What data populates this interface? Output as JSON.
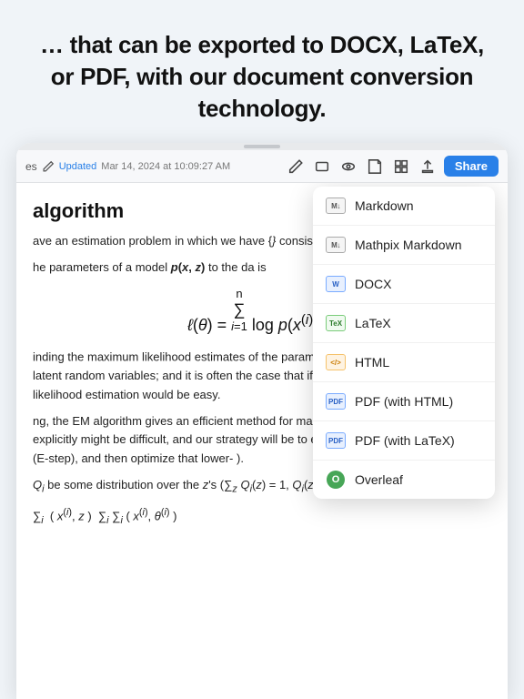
{
  "headline": {
    "text": "… that can be exported to DOCX, LaTeX, or PDF, with our document conversion technology."
  },
  "toolbar": {
    "filename": "es",
    "edit_icon": "pencil",
    "updated_label": "Updated",
    "date": "Mar 14, 2024 at 10:09:27 AM",
    "icons": [
      "pencil-icon",
      "rectangle-icon",
      "eye-icon",
      "document-icon",
      "grid-icon",
      "upload-icon"
    ],
    "share_label": "Share"
  },
  "document": {
    "title": "algorithm",
    "paragraphs": [
      "ave an estimation problem in which we have {} consisting of m independent examples.",
      "he parameters of a model p(x, z) to the da is",
      "",
      "inding the maximum likelihood estimates of the parameters θ may be z(i) 's are the latent random variables; and it is often the case that if the erved, then maximum likelihood estimation would be easy.",
      "ng, the EM algorithm gives an efficient method for maximum likelihood ximizing ℓ(θ) explicitly might be difficult, and our strategy will be to edly construct a lower-bound on ℓ (E-step), and then optimize that lower- ).",
      "Qi be some distribution over the z's (∑z Qi(z) = 1, Qi(z) ≥ 0). llowing:"
    ],
    "math_block": "ℓ(θ) = ∑ log p(x(i); θ)"
  },
  "dropdown": {
    "items": [
      {
        "id": "markdown",
        "label": "Markdown",
        "icon": "md-icon"
      },
      {
        "id": "mathpix-markdown",
        "label": "Mathpix Markdown",
        "icon": "md-icon"
      },
      {
        "id": "docx",
        "label": "DOCX",
        "icon": "docx-icon"
      },
      {
        "id": "latex",
        "label": "LaTeX",
        "icon": "latex-icon"
      },
      {
        "id": "html",
        "label": "HTML",
        "icon": "html-icon"
      },
      {
        "id": "pdf-html",
        "label": "PDF (with HTML)",
        "icon": "pdf-icon"
      },
      {
        "id": "pdf-latex",
        "label": "PDF (with LaTeX)",
        "icon": "pdf-icon"
      },
      {
        "id": "overleaf",
        "label": "Overleaf",
        "icon": "overleaf-icon"
      }
    ]
  }
}
